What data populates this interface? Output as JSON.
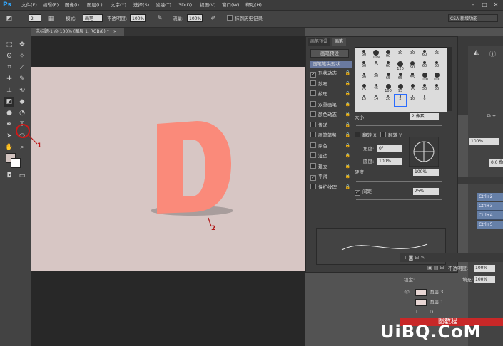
{
  "menubar": {
    "items": [
      "文件(F)",
      "编辑(E)",
      "图像(I)",
      "图层(L)",
      "文字(Y)",
      "选择(S)",
      "滤镜(T)",
      "3D(D)",
      "视图(V)",
      "窗口(W)",
      "帮助(H)"
    ]
  },
  "options": {
    "brush_size": "2",
    "mode_label": "模式:",
    "mode_value": "画笔",
    "opacity_label": "不透明度:",
    "opacity_value": "100%",
    "flow_label": "流量:",
    "flow_value": "100%",
    "history_label": "抹到历史记录",
    "workspace_value": "CSA 新增功能"
  },
  "document": {
    "tab_title": "未标题-1 @ 100% (图层 1, RGB/8) *"
  },
  "brush_panel": {
    "tabs": [
      "画笔预设",
      "画笔"
    ],
    "preset_button": "画笔预设",
    "tip_shape_label": "画笔笔尖形状",
    "options": [
      {
        "label": "形状动态",
        "checked": true
      },
      {
        "label": "散布",
        "checked": false
      },
      {
        "label": "纹理",
        "checked": false
      },
      {
        "label": "双重画笔",
        "checked": false
      },
      {
        "label": "颜色动态",
        "checked": false
      },
      {
        "label": "传递",
        "checked": false
      },
      {
        "label": "画笔笔势",
        "checked": false
      },
      {
        "label": "杂色",
        "checked": false
      },
      {
        "label": "湿边",
        "checked": false
      },
      {
        "label": "建立",
        "checked": false
      },
      {
        "label": "平滑",
        "checked": true
      },
      {
        "label": "保护纹理",
        "checked": false
      }
    ],
    "tip_sizes": [
      "60",
      "119",
      "90",
      "30",
      "30",
      "60",
      "25",
      "50",
      "25",
      "60",
      "120",
      "90",
      "60",
      "50",
      "36",
      "30",
      "65",
      "65",
      "55",
      "100",
      "100",
      "75",
      "45",
      "100",
      "95",
      "75",
      "50",
      "50",
      "15",
      "14",
      "20",
      "2",
      "10",
      "6"
    ],
    "size_label": "大小",
    "size_value": "2 像素",
    "flip_x_label": "翻转 X",
    "flip_y_label": "翻转 Y",
    "angle_label": "角度:",
    "angle_value": "0°",
    "roundness_label": "圆度:",
    "roundness_value": "100%",
    "hardness_label": "硬度",
    "hardness_value": "100%",
    "spacing_label": "间距",
    "spacing_value": "25%"
  },
  "canvas": {
    "letter": "D",
    "letter_color": "#fa8a7a",
    "background_color": "#d7c6c4",
    "annotation_1": "1",
    "annotation_2": "2"
  },
  "right_dock": {
    "shortcuts": [
      "Ctrl+2",
      "Ctrl+3",
      "Ctrl+4",
      "Ctrl+5"
    ],
    "percent_1": "100%",
    "zero_value": "0.0 像素",
    "opacity_label": "不透明度:",
    "opacity_value": "100%",
    "fill_label": "填充:",
    "fill_value": "100%",
    "lock_label": "锁定:",
    "layers": [
      "图层 3",
      "图层 1",
      "D",
      "图教程"
    ]
  },
  "watermark": "UiBQ.CoM"
}
